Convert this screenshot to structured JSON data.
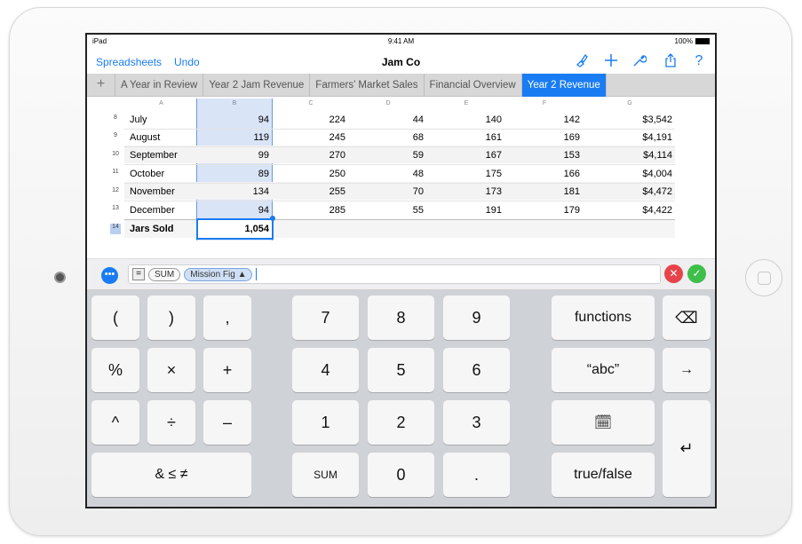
{
  "status": {
    "device": "iPad",
    "time": "9:41 AM",
    "battery": "100%"
  },
  "toolbar": {
    "back_label": "Spreadsheets",
    "undo_label": "Undo",
    "title": "Jam Co",
    "icons": [
      "brush-icon",
      "plus-icon",
      "wrench-icon",
      "share-icon",
      "help-icon"
    ],
    "help_glyph": "?"
  },
  "tabs": [
    "A Year in Review",
    "Year 2 Jam Revenue",
    "Farmers’ Market Sales",
    "Financial Overview",
    "Year 2 Revenue"
  ],
  "add_tab_glyph": "+",
  "active_tab": 4,
  "columns": [
    "A",
    "B",
    "C",
    "D",
    "E",
    "F",
    "G"
  ],
  "rows": [
    {
      "num": "8",
      "label": "July",
      "b": "94",
      "c": "224",
      "d": "44",
      "e": "140",
      "f": "142",
      "g": "$3,542"
    },
    {
      "num": "9",
      "label": "August",
      "b": "119",
      "c": "245",
      "d": "68",
      "e": "161",
      "f": "169",
      "g": "$4,191"
    },
    {
      "num": "10",
      "label": "September",
      "b": "99",
      "c": "270",
      "d": "59",
      "e": "167",
      "f": "153",
      "g": "$4,114"
    },
    {
      "num": "11",
      "label": "October",
      "b": "89",
      "c": "250",
      "d": "48",
      "e": "175",
      "f": "166",
      "g": "$4,004"
    },
    {
      "num": "12",
      "label": "November",
      "b": "134",
      "c": "255",
      "d": "70",
      "e": "173",
      "f": "181",
      "g": "$4,472"
    },
    {
      "num": "13",
      "label": "December",
      "b": "94",
      "c": "285",
      "d": "55",
      "e": "191",
      "f": "179",
      "g": "$4,422"
    }
  ],
  "total_row": {
    "num": "14",
    "label": "Jars Sold",
    "value": "1,054"
  },
  "formula": {
    "function": "SUM",
    "reference": "Mission Fig ▲",
    "more_glyph": "•••",
    "equals_glyph": "=",
    "cancel_glyph": "✕",
    "accept_glyph": "✓"
  },
  "keyboard": {
    "symbols": [
      "(",
      ")",
      ",",
      "%",
      "×",
      "+",
      "^",
      "÷",
      "–",
      "& ≤ ≠"
    ],
    "digits": [
      "7",
      "8",
      "9",
      "4",
      "5",
      "6",
      "1",
      "2",
      "3",
      "SUM",
      "0",
      "."
    ],
    "functions_label": "functions",
    "text_label": "“abc”",
    "bool_label": "true/false",
    "delete_glyph": "⌫",
    "tab_glyph": "→",
    "return_glyph": "↵",
    "date_glyph": "🗓"
  },
  "colors": {
    "accent": "#1a7cf2",
    "cancel": "#e8434a",
    "accept": "#3fbe4a"
  }
}
